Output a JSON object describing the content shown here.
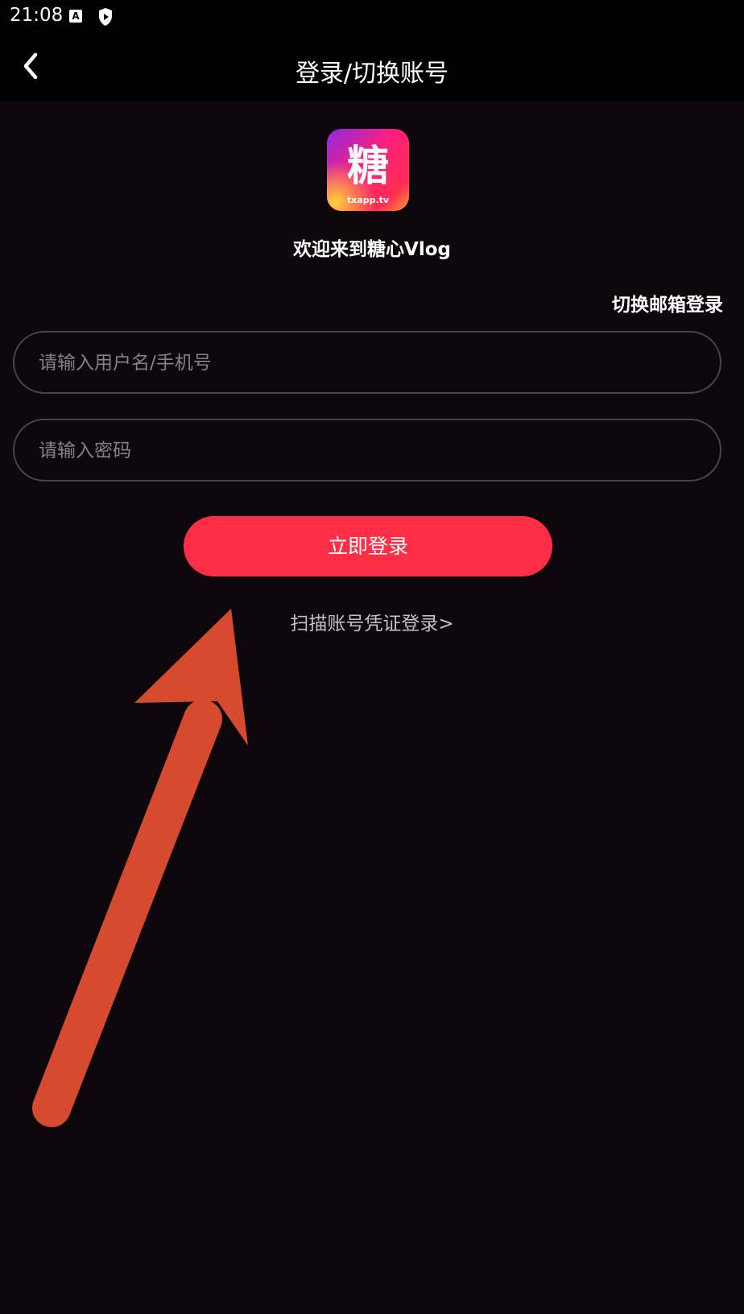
{
  "status_bar": {
    "time": "21:08",
    "icons": [
      "accessibility-a-icon",
      "shield-play-icon"
    ]
  },
  "header": {
    "back_icon": "chevron-left-icon",
    "title": "登录/切换账号"
  },
  "logo": {
    "glyph": "糖",
    "caption": "txapp.tv"
  },
  "welcome_text": "欢迎来到糖心Vlog",
  "switch_email_link": "切换邮箱登录",
  "form": {
    "username_placeholder": "请输入用户名/手机号",
    "username_value": "",
    "password_placeholder": "请输入密码",
    "password_value": ""
  },
  "login_button": "立即登录",
  "scan_link": "扫描账号凭证登录>",
  "colors": {
    "background": "#0d070b",
    "header": "#000000",
    "accent": "#ff2d45",
    "annotation_arrow": "#d64a30"
  }
}
